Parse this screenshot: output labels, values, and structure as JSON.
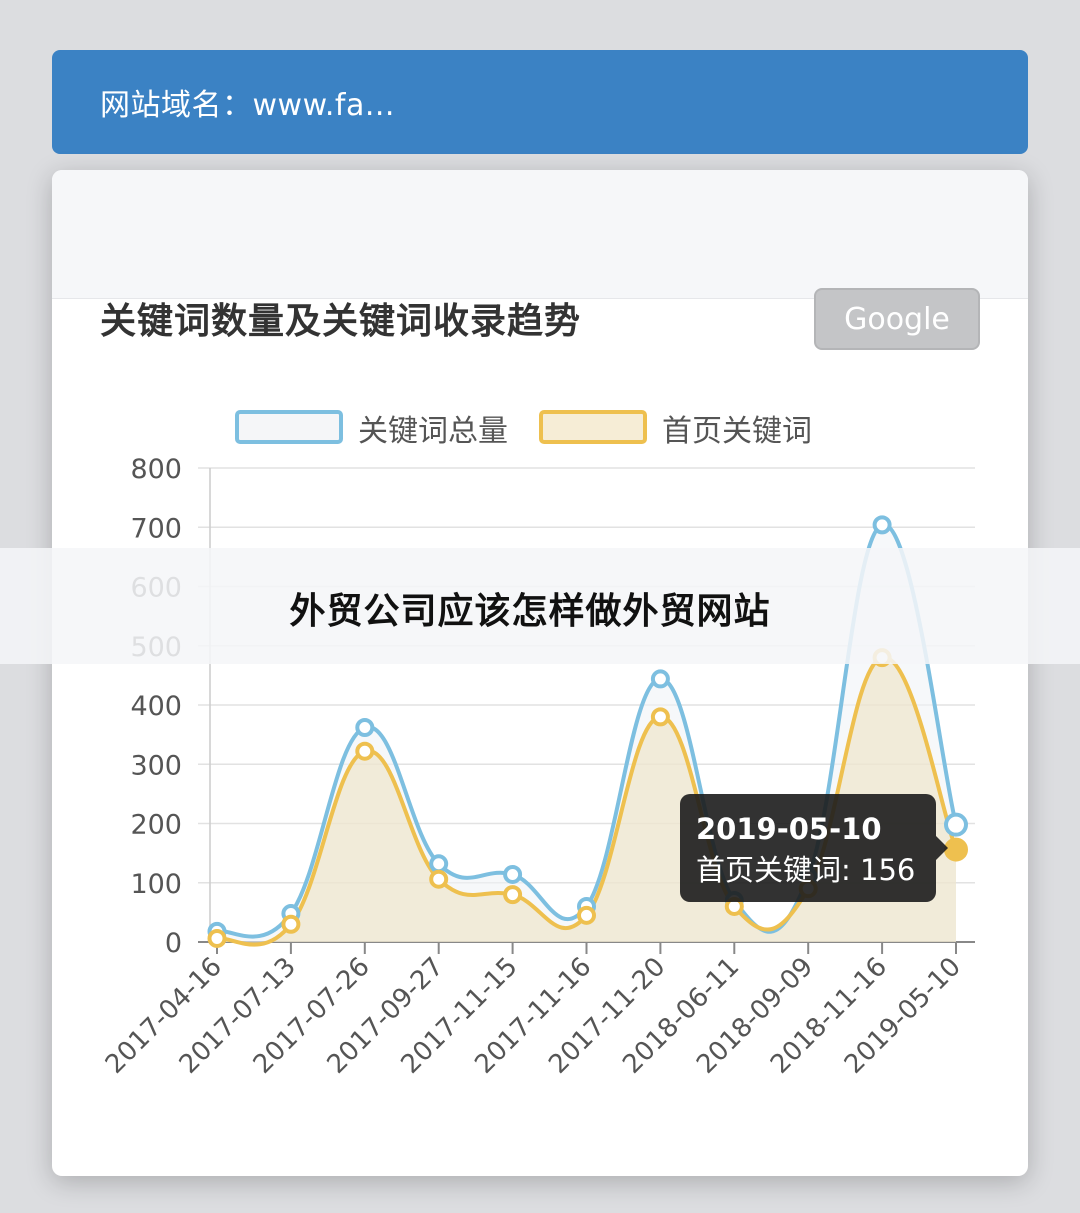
{
  "domain_bar": {
    "label": "网站域名：www.fa..."
  },
  "card": {
    "title": "关键词数量及关键词收录趋势",
    "engine_button": "Google"
  },
  "overlay_text": "外贸公司应该怎样做外贸网站",
  "tooltip": {
    "date": "2019-05-10",
    "label": "首页关键词: 156"
  },
  "colors": {
    "total": "#7dbfe0",
    "home": "#eec04f",
    "accent": "#3b82c4"
  },
  "chart_data": {
    "type": "area",
    "title": "关键词数量及关键词收录趋势",
    "x": [
      "2017-04-16",
      "2017-07-13",
      "2017-07-26",
      "2017-09-27",
      "2017-11-15",
      "2017-11-16",
      "2017-11-20",
      "2018-06-11",
      "2018-09-09",
      "2018-11-16",
      "2019-05-10"
    ],
    "series": [
      {
        "name": "关键词总量",
        "values": [
          18,
          48,
          362,
          132,
          114,
          60,
          444,
          70,
          110,
          704,
          198
        ]
      },
      {
        "name": "首页关键词",
        "values": [
          6,
          30,
          322,
          106,
          80,
          45,
          380,
          60,
          90,
          480,
          156
        ]
      }
    ],
    "ylim": [
      0,
      800
    ],
    "yticks": [
      0,
      100,
      200,
      300,
      400,
      500,
      600,
      700,
      800
    ],
    "grid": true,
    "legend_position": "top"
  }
}
